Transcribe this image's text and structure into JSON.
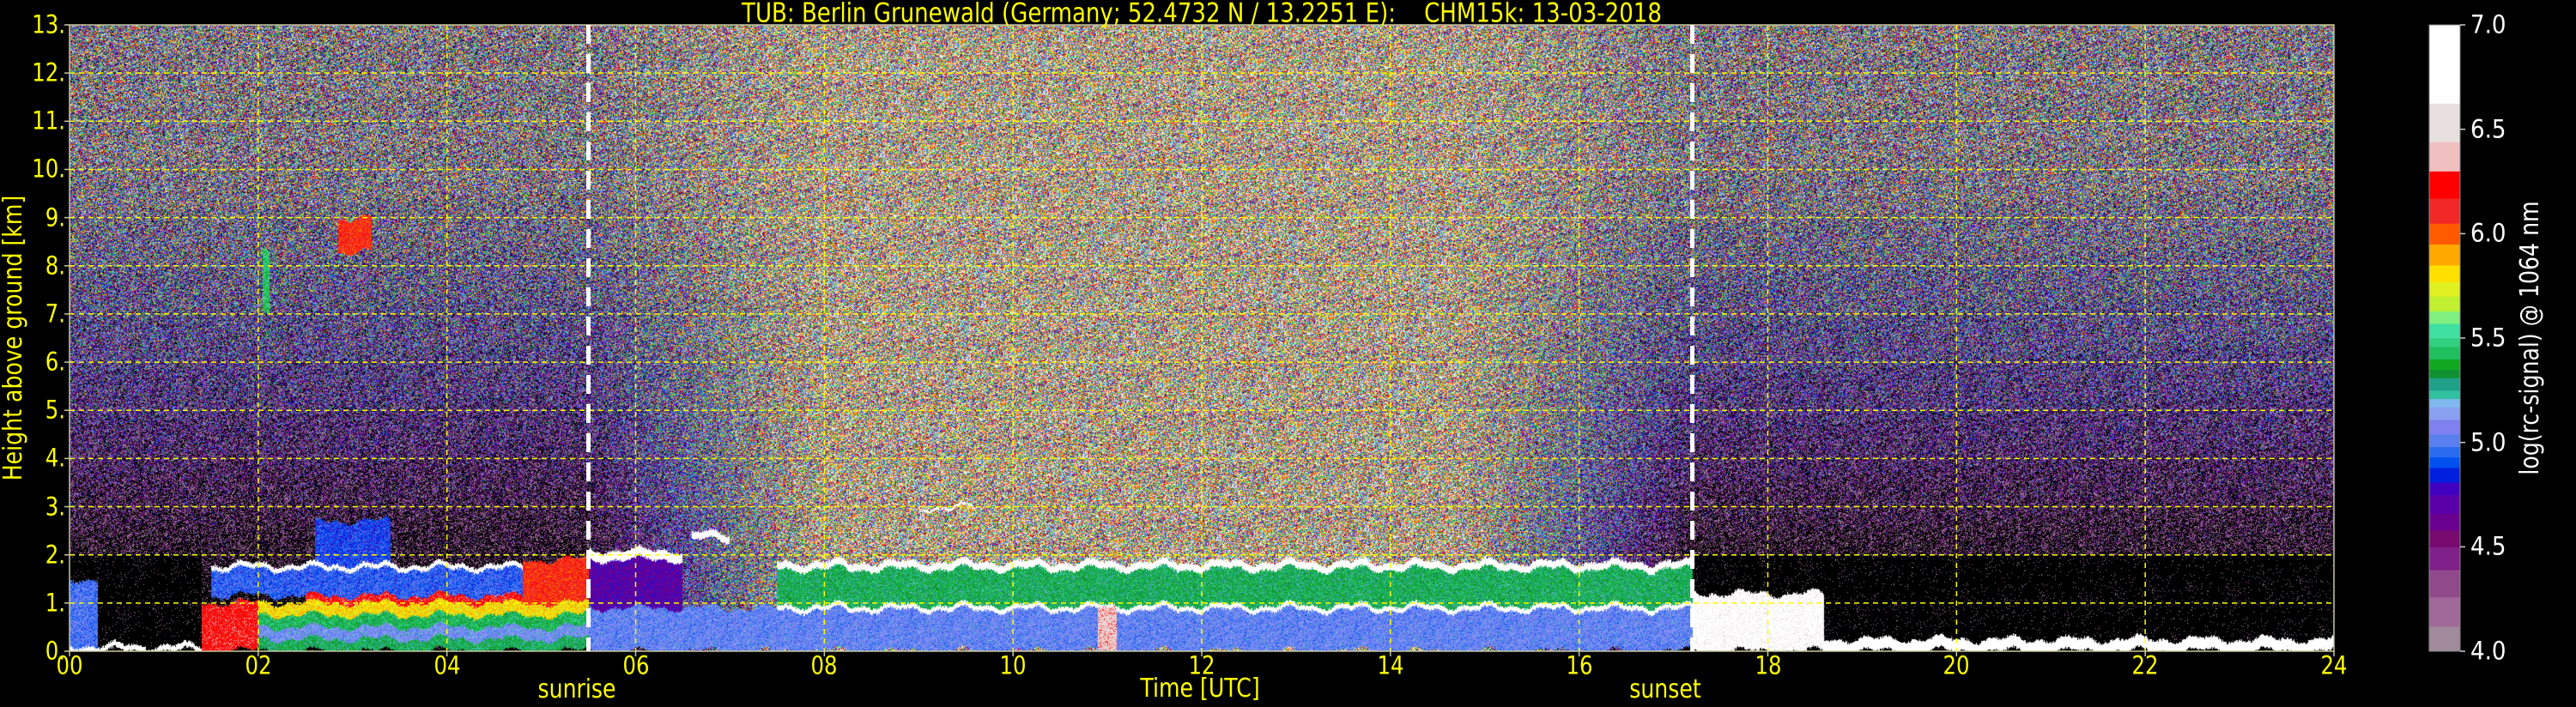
{
  "chart_data": {
    "type": "heatmap",
    "title": "TUB: Berlin Grunewald (Germany; 52.4732 N / 13.2251 E):    CHM15k: 13-03-2018",
    "xlabel": "Time [UTC]",
    "ylabel": "Height above ground [km]",
    "xlim": [
      0,
      24
    ],
    "ylim": [
      0,
      13
    ],
    "xticks": [
      0,
      2,
      4,
      6,
      8,
      10,
      12,
      14,
      16,
      18,
      20,
      22,
      24
    ],
    "xticklabels": [
      "00",
      "02",
      "04",
      "06",
      "08",
      "10",
      "12",
      "14",
      "16",
      "18",
      "20",
      "22",
      "24"
    ],
    "yticks": [
      0,
      1,
      2,
      3,
      4,
      5,
      6,
      7,
      8,
      9,
      10,
      11,
      12,
      13
    ],
    "yticklabels": [
      "0.",
      "1.",
      "2.",
      "3.",
      "4.",
      "5.",
      "6.",
      "7.",
      "8.",
      "9.",
      "10.",
      "11.",
      "12.",
      "13."
    ],
    "grid": true,
    "annotations": [
      {
        "label": "sunrise",
        "time": 5.5
      },
      {
        "label": "sunset",
        "time": 17.2
      }
    ],
    "colorbar": {
      "label": "log(rc-signal) @ 1064 nm",
      "range": [
        4.0,
        7.0
      ],
      "ticks": [
        4.0,
        4.5,
        5.0,
        5.5,
        6.0,
        6.5,
        7.0
      ],
      "ticklabels": [
        "4.0",
        "4.5",
        "5.0",
        "5.5",
        "6.0",
        "6.5",
        "7.0"
      ],
      "segments": [
        [
          4.0,
          4.12,
          "#a08a9c"
        ],
        [
          4.12,
          4.26,
          "#a06898"
        ],
        [
          4.26,
          4.39,
          "#904a8c"
        ],
        [
          4.39,
          4.5,
          "#80208a"
        ],
        [
          4.5,
          4.58,
          "#780a70"
        ],
        [
          4.58,
          4.66,
          "#6a0090"
        ],
        [
          4.66,
          4.75,
          "#5a00a8"
        ],
        [
          4.75,
          4.81,
          "#4000c0"
        ],
        [
          4.81,
          4.88,
          "#0020e0"
        ],
        [
          4.88,
          4.93,
          "#0050f0"
        ],
        [
          4.93,
          4.98,
          "#2a6cf0"
        ],
        [
          4.98,
          5.04,
          "#5a80f0"
        ],
        [
          5.04,
          5.11,
          "#8080f0"
        ],
        [
          5.11,
          5.17,
          "#8aa0f0"
        ],
        [
          5.17,
          5.21,
          "#80b8f0"
        ],
        [
          5.21,
          5.25,
          "#30c0a0"
        ],
        [
          5.25,
          5.31,
          "#20a088"
        ],
        [
          5.31,
          5.35,
          "#109030"
        ],
        [
          5.35,
          5.4,
          "#10a820"
        ],
        [
          5.4,
          5.46,
          "#20c060"
        ],
        [
          5.46,
          5.5,
          "#30d080"
        ],
        [
          5.5,
          5.57,
          "#40e0a0"
        ],
        [
          5.57,
          5.63,
          "#80f080"
        ],
        [
          5.63,
          5.7,
          "#c0f030"
        ],
        [
          5.7,
          5.77,
          "#e0f020"
        ],
        [
          5.77,
          5.85,
          "#ffe000"
        ],
        [
          5.85,
          5.95,
          "#ffa800"
        ],
        [
          5.95,
          6.05,
          "#ff5a00"
        ],
        [
          6.05,
          6.17,
          "#f02828"
        ],
        [
          6.17,
          6.3,
          "#ff0000"
        ],
        [
          6.3,
          6.44,
          "#f0c0c0"
        ],
        [
          6.44,
          6.625,
          "#e8e0e0"
        ],
        [
          6.625,
          7.0,
          "#ffffff"
        ]
      ]
    },
    "layers": [
      {
        "t": [
          0,
          0.3
        ],
        "h": [
          0.12,
          1.5
        ],
        "v": 5.0
      },
      {
        "t": [
          0,
          1.4
        ],
        "h": [
          0,
          0.12
        ],
        "v": 6.8
      },
      {
        "t": [
          1.4,
          5.5
        ],
        "h": [
          0,
          0.25
        ],
        "v": 5.35
      },
      {
        "t": [
          2.0,
          5.5
        ],
        "h": [
          0.25,
          0.5
        ],
        "v": 5.1
      },
      {
        "t": [
          2.0,
          5.5
        ],
        "h": [
          0.5,
          0.75
        ],
        "v": 5.4
      },
      {
        "t": [
          2.0,
          5.5
        ],
        "h": [
          0.75,
          1.0
        ],
        "v": 5.8
      },
      {
        "t": [
          2.5,
          5.5
        ],
        "h": [
          1.0,
          1.15
        ],
        "v": 6.2
      },
      {
        "t": [
          1.4,
          2.0
        ],
        "h": [
          0,
          1.0
        ],
        "v": 6.2
      },
      {
        "t": [
          1.5,
          4.8
        ],
        "h": [
          1.15,
          1.7
        ],
        "v": 4.95
      },
      {
        "t": [
          1.5,
          4.8
        ],
        "h": [
          1.7,
          1.8
        ],
        "v": 6.8
      },
      {
        "t": [
          2.6,
          3.4
        ],
        "h": [
          1.8,
          2.7
        ],
        "v": 4.9
      },
      {
        "t": [
          4.8,
          5.5
        ],
        "h": [
          1.0,
          1.9
        ],
        "v": 6.1
      },
      {
        "t": [
          5.5,
          7.5
        ],
        "h": [
          0,
          0.9
        ],
        "v": 5.05
      },
      {
        "t": [
          5.5,
          6.5
        ],
        "h": [
          0.9,
          1.9
        ],
        "v": 4.7
      },
      {
        "t": [
          5.5,
          6.5
        ],
        "h": [
          1.9,
          2.1
        ],
        "v": 6.8
      },
      {
        "t": [
          6.6,
          7.0
        ],
        "h": [
          2.3,
          2.45
        ],
        "v": 6.8
      },
      {
        "t": [
          7.5,
          17.2
        ],
        "h": [
          0,
          0.85
        ],
        "v": 5.05
      },
      {
        "t": [
          7.5,
          17.2
        ],
        "h": [
          0.85,
          0.95
        ],
        "v": 6.8
      },
      {
        "t": [
          7.5,
          17.2
        ],
        "h": [
          0.95,
          1.7
        ],
        "v": 5.35
      },
      {
        "t": [
          7.5,
          17.2
        ],
        "h": [
          1.7,
          1.85
        ],
        "v": 6.8
      },
      {
        "t": [
          9.0,
          9.6
        ],
        "h": [
          2.95,
          3.0
        ],
        "v": 6.8
      },
      {
        "t": [
          10.9,
          11.1
        ],
        "h": [
          0,
          0.9
        ],
        "v": 6.4
      },
      {
        "t": [
          17.2,
          18.6
        ],
        "h": [
          0,
          1.2
        ],
        "v": 6.7
      },
      {
        "t": [
          18.6,
          24
        ],
        "h": [
          0,
          0.25
        ],
        "v": 6.8
      },
      {
        "t": [
          2.85,
          3.2
        ],
        "h": [
          8.3,
          9.0
        ],
        "v": 6.1
      },
      {
        "t": [
          2.05,
          2.12
        ],
        "h": [
          7.0,
          8.3
        ],
        "v": 5.45
      }
    ]
  }
}
